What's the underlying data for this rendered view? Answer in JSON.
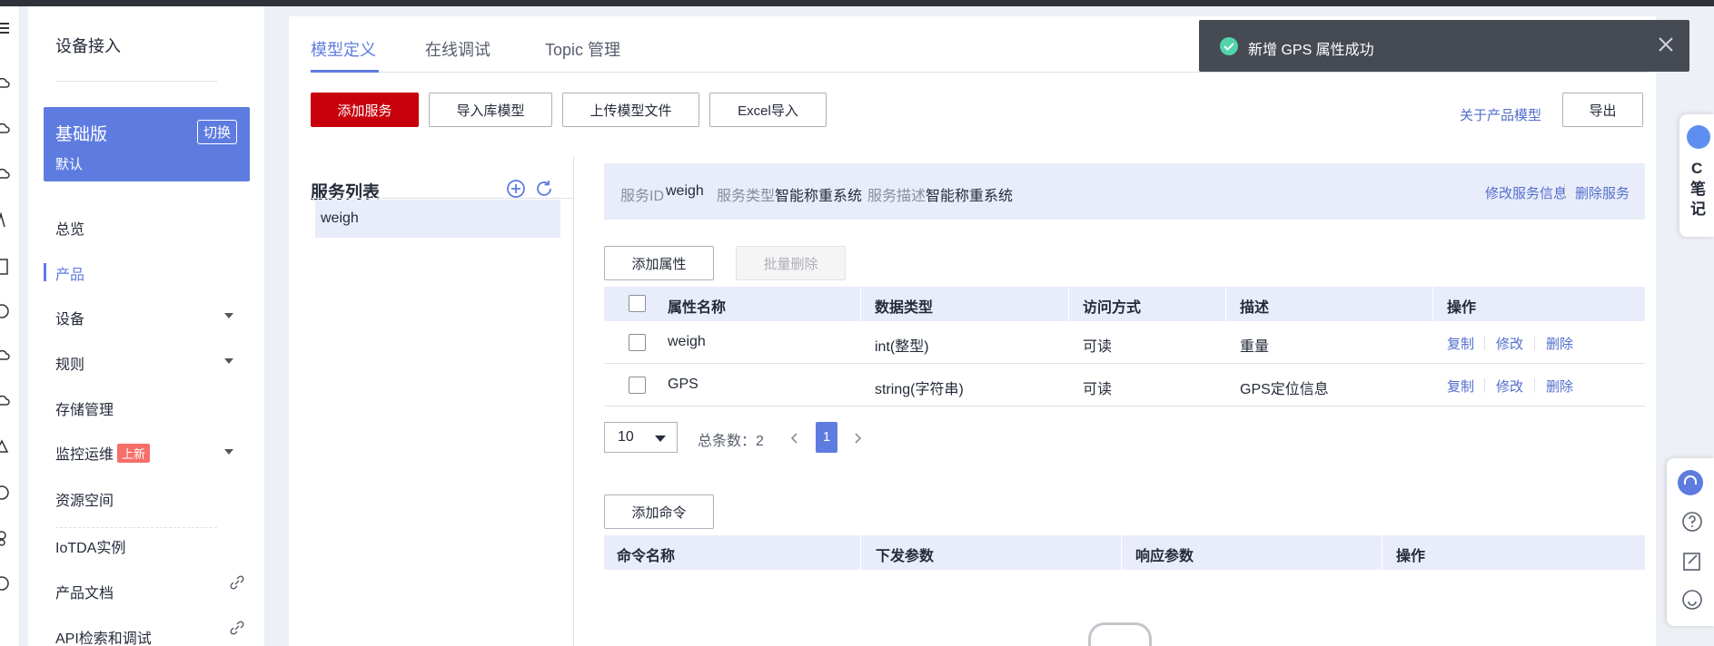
{
  "sidebar": {
    "title": "设备接入",
    "edition": {
      "name": "基础版",
      "sub": "默认",
      "switch_label": "切换"
    },
    "items": [
      {
        "label": "总览"
      },
      {
        "label": "产品"
      },
      {
        "label": "设备"
      },
      {
        "label": "规则"
      },
      {
        "label": "存储管理"
      },
      {
        "label": "监控运维",
        "badge": "上新"
      },
      {
        "label": "资源空间"
      },
      {
        "label": "IoTDA实例"
      },
      {
        "label": "产品文档"
      },
      {
        "label": "API检索和调试"
      }
    ]
  },
  "tabs": [
    {
      "label": "模型定义"
    },
    {
      "label": "在线调试"
    },
    {
      "label": "Topic 管理"
    }
  ],
  "toolbar": {
    "add_service": "添加服务",
    "import_lib": "导入库模型",
    "upload_file": "上传模型文件",
    "excel_import": "Excel导入",
    "about_model": "关于产品模型",
    "export": "导出"
  },
  "service_list": {
    "title": "服务列表",
    "items": [
      "weigh"
    ]
  },
  "service_info": {
    "id_label": "服务ID",
    "id_value": "weigh",
    "type_label": "服务类型",
    "type_value": "智能称重系统",
    "desc_label": "服务描述",
    "desc_value": "智能称重系统",
    "edit_link": "修改服务信息",
    "delete_link": "删除服务"
  },
  "properties": {
    "add_button": "添加属性",
    "batch_delete": "批量删除",
    "columns": [
      "属性名称",
      "数据类型",
      "访问方式",
      "描述",
      "操作"
    ],
    "rows": [
      {
        "name": "weigh",
        "type": "int(整型)",
        "access": "可读",
        "desc": "重量"
      },
      {
        "name": "GPS",
        "type": "string(字符串)",
        "access": "可读",
        "desc": "GPS定位信息"
      }
    ],
    "ops": [
      "复制",
      "修改",
      "删除"
    ]
  },
  "pager": {
    "page_size": "10",
    "total_label": "总条数：2",
    "current_page": "1"
  },
  "commands": {
    "add_button": "添加命令",
    "columns": [
      "命令名称",
      "下发参数",
      "响应参数",
      "操作"
    ]
  },
  "toast": {
    "message": "新增 GPS 属性成功"
  },
  "right_float": {
    "note_letter": "C",
    "note_text": "笔记"
  },
  "colors": {
    "accent": "#5e7ce0",
    "primary_red": "#c7000b",
    "header_bg": "#e9edfa",
    "toast_bg": "#464a53",
    "success": "#50d4ab",
    "badge": "#f66f6a"
  }
}
